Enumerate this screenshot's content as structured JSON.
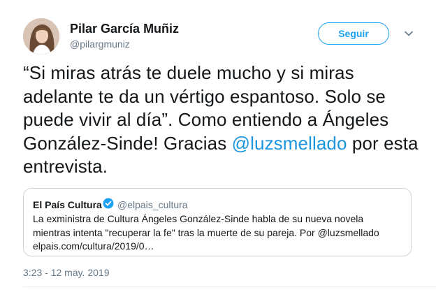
{
  "author": {
    "name": "Pilar García Muñiz",
    "handle": "@pilargmuniz",
    "avatar_icon": "user-avatar"
  },
  "actions": {
    "follow_label": "Seguir",
    "menu_icon": "chevron-down-icon"
  },
  "tweet": {
    "text_before": "“Si miras atrás te duele mucho y si miras adelante te da un vértigo espantoso. Solo se puede vivir al día”. Como entiendo a Ángeles González-Sinde! Gracias ",
    "mention": "@luzsmellado",
    "text_after": " por esta entrevista.",
    "timestamp": "3:23 - 12 may. 2019"
  },
  "quoted": {
    "name": "El País Cultura",
    "handle": "@elpais_cultura",
    "text": "La exministra de Cultura Ángeles González-Sinde habla de su nueva novela mientras intenta \"recuperar la fe\" tras la muerte de su pareja. Por @luzsmellado elpais.com/cultura/2019/0…"
  },
  "colors": {
    "accent": "#1da1f2",
    "link": "#1b95e0",
    "secondary_text": "#657786",
    "border": "#ccd6dd"
  }
}
